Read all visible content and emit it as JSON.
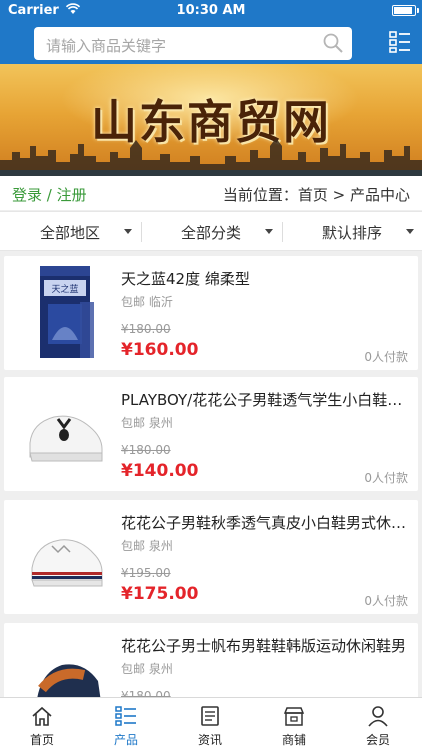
{
  "status_bar": {
    "carrier": "Carrier",
    "time": "10:30 AM"
  },
  "search": {
    "placeholder": "请输入商品关键字"
  },
  "banner": {
    "title": "山东商贸网"
  },
  "breadcrumb": {
    "login": "登录 / 注册",
    "location": "当前位置：首页 > 产品中心"
  },
  "filters": [
    "全部地区",
    "全部分类",
    "默认排序"
  ],
  "products": [
    {
      "name": "天之蓝42度 绵柔型",
      "shipping": "包邮",
      "city": "临沂",
      "original_price": "¥180.00",
      "price": "¥160.00",
      "sold": "0人付款",
      "image": "liquor-bottle"
    },
    {
      "name": "PLAYBOY/花花公子男鞋透气学生小白鞋男式休闲鞋",
      "shipping": "包邮",
      "city": "泉州",
      "original_price": "¥180.00",
      "price": "¥140.00",
      "sold": "0人付款",
      "image": "white-sneaker"
    },
    {
      "name": "花花公子男鞋秋季透气真皮小白鞋男式休闲板鞋",
      "shipping": "包邮",
      "city": "泉州",
      "original_price": "¥195.00",
      "price": "¥175.00",
      "sold": "0人付款",
      "image": "white-striped-sneaker"
    },
    {
      "name": "花花公子男士帆布男鞋鞋韩版运动休闲鞋男",
      "shipping": "包邮",
      "city": "泉州",
      "original_price": "¥180.00",
      "price": "",
      "sold": "",
      "image": "canvas-shoe"
    }
  ],
  "tabbar": [
    {
      "label": "首页",
      "icon": "home-icon",
      "active": false
    },
    {
      "label": "产品",
      "icon": "product-list-icon",
      "active": true
    },
    {
      "label": "资讯",
      "icon": "news-icon",
      "active": false
    },
    {
      "label": "商铺",
      "icon": "shop-icon",
      "active": false
    },
    {
      "label": "会员",
      "icon": "user-icon",
      "active": false
    }
  ],
  "colors": {
    "header": "#1f78c8",
    "price": "#e4242a",
    "login": "#3a9a3a",
    "active_tab": "#1f78c8"
  }
}
